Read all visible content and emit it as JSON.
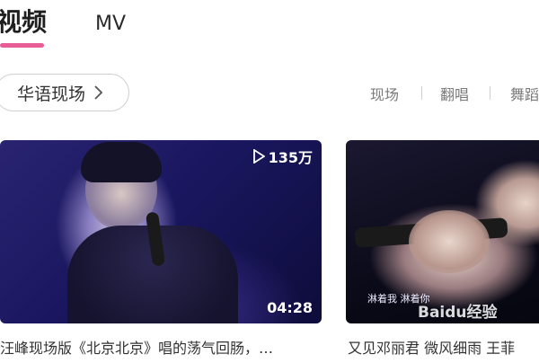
{
  "tabs": [
    {
      "label": "视频",
      "active": true
    },
    {
      "label": "MV",
      "active": false
    }
  ],
  "category": {
    "label": "华语现场"
  },
  "filters": [
    "现场",
    "翻唱",
    "舞蹈"
  ],
  "videos": [
    {
      "views": "135万",
      "duration": "04:28",
      "title": "汪峰现场版《北京北京》唱的荡气回肠，…"
    },
    {
      "subtitle": "淋着我  淋着你",
      "watermark": "Baidu经验",
      "title": "又见邓丽君 微风细雨 王菲"
    }
  ],
  "colors": {
    "accent": "#e85d95",
    "text": "#333333",
    "muted": "#7a7a7a"
  }
}
